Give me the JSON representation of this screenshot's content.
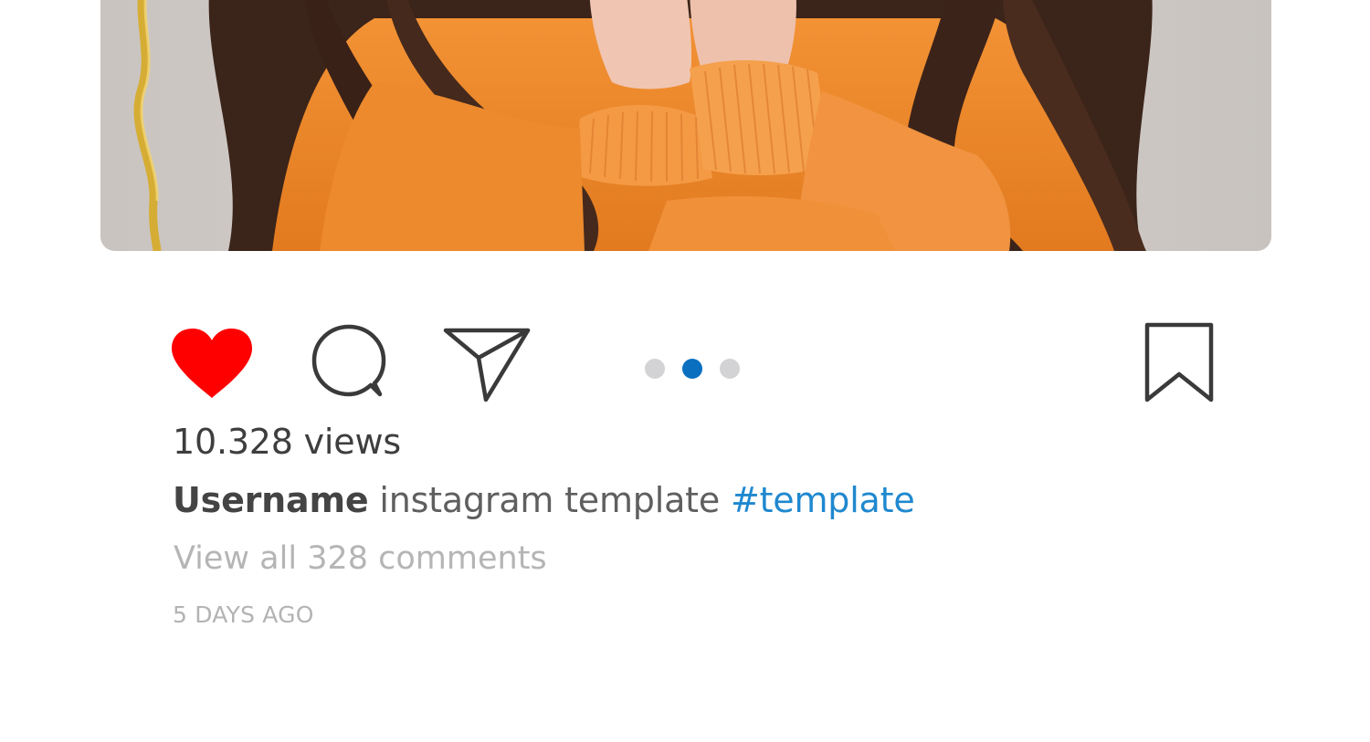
{
  "post": {
    "photo": {
      "alt": "",
      "colors": {
        "background_wall": "#cdc8c4",
        "sweater": "#f08a2c",
        "hair": "#3a2218",
        "skin": "#f0c9b6",
        "gold_ring": "#d8b23a"
      }
    },
    "actions": {
      "like_icon": "heart-filled-icon",
      "comment_icon": "speech-bubble-icon",
      "share_icon": "paper-plane-icon",
      "save_icon": "bookmark-icon",
      "like_color": "#ff0000"
    },
    "carousel": {
      "total": 3,
      "active_index": 1,
      "active_color": "#0a6fbf",
      "inactive_color": "#d3d3d6"
    },
    "views": "10.328 views",
    "caption": {
      "username": "Username",
      "text": "instagram template",
      "hashtag": "#template"
    },
    "view_comments": "View all 328 comments",
    "timestamp": "5 DAYS AGO"
  }
}
